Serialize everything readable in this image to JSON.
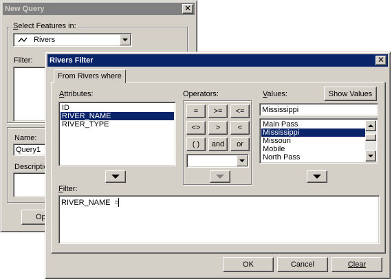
{
  "new_query": {
    "title": "New Query",
    "select_features_label_u": "S",
    "select_features_label_rest": "elect Features in:",
    "layer_value": "Rivers",
    "filter_label": "Filter:",
    "name_label": "Name:",
    "name_value": "Query1",
    "description_label": "Descriptio",
    "op_button_label": "Op"
  },
  "rivers_filter": {
    "title": "Rivers Filter",
    "tab_label": "From Rivers where",
    "attributes_label": "Attributes:",
    "attributes": [
      "ID",
      "RIVER_NAME",
      "RIVER_TYPE"
    ],
    "attributes_selected_index": 1,
    "operators_label": "Operators:",
    "operators": {
      "eq": "=",
      "ge": ">=",
      "le": "<=",
      "ne": "<>",
      "gt": ">",
      "lt": "<",
      "parens": "( )",
      "and": "and",
      "or": "or"
    },
    "values_label": "Values:",
    "show_values_label": "Show Values",
    "values_search": "Mississippi",
    "values": [
      "Main Pass",
      "Mississippi",
      "Missouri",
      "Mobile",
      "North Pass"
    ],
    "values_selected_index": 1,
    "filter_label": "Filter:",
    "filter_text": "RIVER_NAME  =",
    "ok_label": "OK",
    "cancel_label": "Cancel",
    "clear_label": "Clear"
  },
  "colors": {
    "active_title": "#0a246a",
    "inactive_title": "#808080",
    "face": "#d4d0c8",
    "selection": "#0a246a"
  }
}
